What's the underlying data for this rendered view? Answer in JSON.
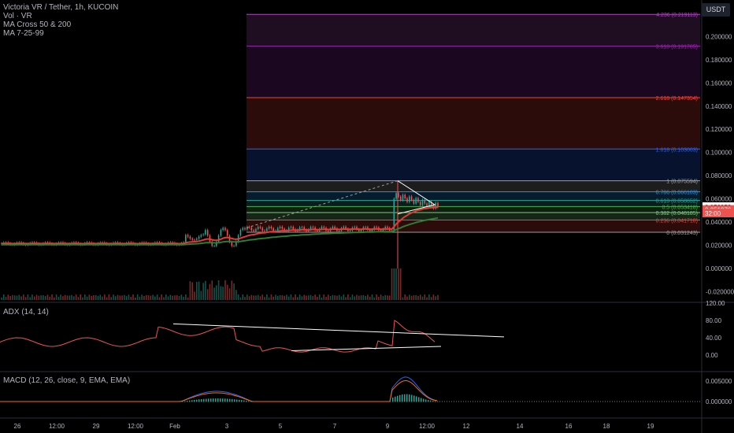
{
  "legend": {
    "title": "Victoria VR / Tether, 1h, KUCOIN",
    "vol": "Vol · VR",
    "ma_cross": "MA Cross 50 & 200",
    "ma_ribbon": "MA 7-25-99"
  },
  "currency_button": "USDT",
  "colors": {
    "background": "#000000",
    "grid_line": "#1a1a1a",
    "axis_text": "#b2b5be",
    "price_badge": "#ffffff",
    "last_price_badge": "#ef5350",
    "ma_fast": "#e53935",
    "ma_slow": "#2e7d32"
  },
  "chart_data": [
    {
      "type": "candlestick-fibonacci",
      "price_axis_ticks": [
        "0.200000",
        "0.180000",
        "0.160000",
        "0.140000",
        "0.120000",
        "0.100000",
        "0.080000",
        "0.060000",
        "0.040000",
        "0.020000",
        "0.000000",
        "-0.020000"
      ],
      "fib_levels": [
        {
          "label": "4.236 (0.219113)",
          "value": 0.219113,
          "color": "#ab47bc"
        },
        {
          "label": "3.618 (0.191705)",
          "value": 0.191705,
          "color": "#9c27b0"
        },
        {
          "label": "2.618 (0.147354)",
          "value": 0.147354,
          "color": "#f44336"
        },
        {
          "label": "1.618 (0.103003)",
          "value": 0.103003,
          "color": "#2962ff"
        },
        {
          "label": "1 (0.075594)",
          "value": 0.075594,
          "color": "#9e9e9e"
        },
        {
          "label": "0.786 (0.066103)",
          "value": 0.066103,
          "color": "#2196f3"
        },
        {
          "label": "0.618 (0.058652)",
          "value": 0.058652,
          "color": "#26a69a"
        },
        {
          "label": "0.5 (0.053418)",
          "value": 0.053418,
          "color": "#4caf50"
        },
        {
          "label": "0.382 (0.048185)",
          "value": 0.048185,
          "color": "#81c784"
        },
        {
          "label": "0.236 (0.041710)",
          "value": 0.04171,
          "color": "#f44336"
        },
        {
          "label": "0 (0.031243)",
          "value": 0.031243,
          "color": "#9e9e9e"
        }
      ],
      "price_labels": [
        {
          "text": "0.052953",
          "kind": "price"
        },
        {
          "text": "0.051976",
          "kind": "last"
        },
        {
          "text": "32:00",
          "kind": "countdown"
        }
      ],
      "time_axis_ticks": [
        "26",
        "12:00",
        "29",
        "12:00",
        "Feb",
        "3",
        "5",
        "7",
        "9",
        "12:00",
        "12",
        "14",
        "16",
        "18",
        "19"
      ]
    },
    {
      "type": "line",
      "name": "ADX (14, 14)",
      "axis_ticks": [
        "120.00",
        "80.00",
        "40.00",
        "0.00"
      ]
    },
    {
      "type": "histogram-line",
      "name": "MACD (12, 26, close, 9, EMA, EMA)",
      "axis_ticks": [
        "0.005000",
        "0.000000"
      ]
    }
  ]
}
